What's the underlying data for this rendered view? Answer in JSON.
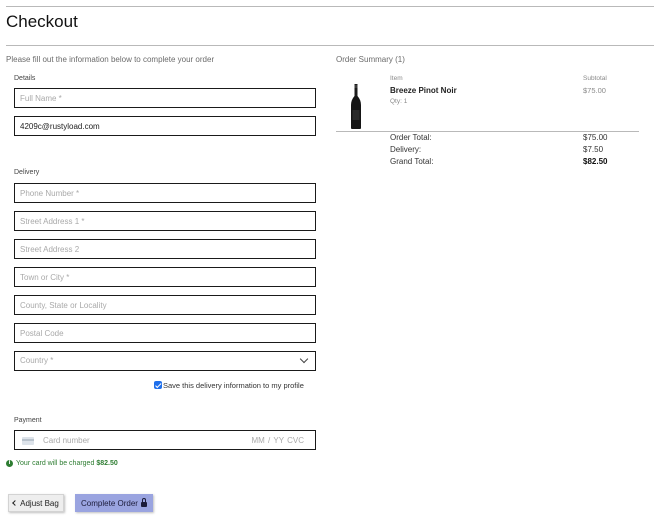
{
  "page": {
    "title": "Checkout"
  },
  "form": {
    "intro": "Please fill out the information below to complete your order",
    "details": {
      "label": "Details",
      "full_name_placeholder": "Full Name *",
      "email_value": "4209c@rustyload.com"
    },
    "delivery": {
      "label": "Delivery",
      "phone_placeholder": "Phone Number *",
      "street1_placeholder": "Street Address 1 *",
      "street2_placeholder": "Street Address 2",
      "town_placeholder": "Town or City *",
      "county_placeholder": "County, State or Locality",
      "postcode_placeholder": "Postal Code",
      "country_placeholder": "Country *",
      "save_label": "Save this delivery information to my profile",
      "save_checked": true
    },
    "payment": {
      "label": "Payment",
      "card_placeholder": "Card number",
      "expiry_cvc_placeholder": "MM / YY  CVC",
      "charge_note": "Your card will be charged",
      "charge_amount": "$82.50"
    },
    "buttons": {
      "adjust_bag": "Adjust Bag",
      "complete_order": "Complete Order"
    }
  },
  "summary": {
    "title": "Order Summary (1)",
    "col_item": "Item",
    "col_subtotal": "Subtotal",
    "item": {
      "name": "Breeze Pinot Noir",
      "qty": "Qty: 1",
      "subtotal": "$75.00"
    },
    "order_total_label": "Order Total:",
    "order_total": "$75.00",
    "delivery_label": "Delivery:",
    "delivery": "$7.50",
    "grand_total_label": "Grand Total:",
    "grand_total": "$82.50"
  },
  "colors": {
    "accent_button": "#9aa4e0",
    "success_text": "#2e7d32",
    "checkbox": "#1f6feb"
  },
  "icons": [
    "card-icon",
    "info-icon",
    "chevron-left-icon",
    "lock-icon",
    "chevron-down-icon",
    "check-icon"
  ]
}
